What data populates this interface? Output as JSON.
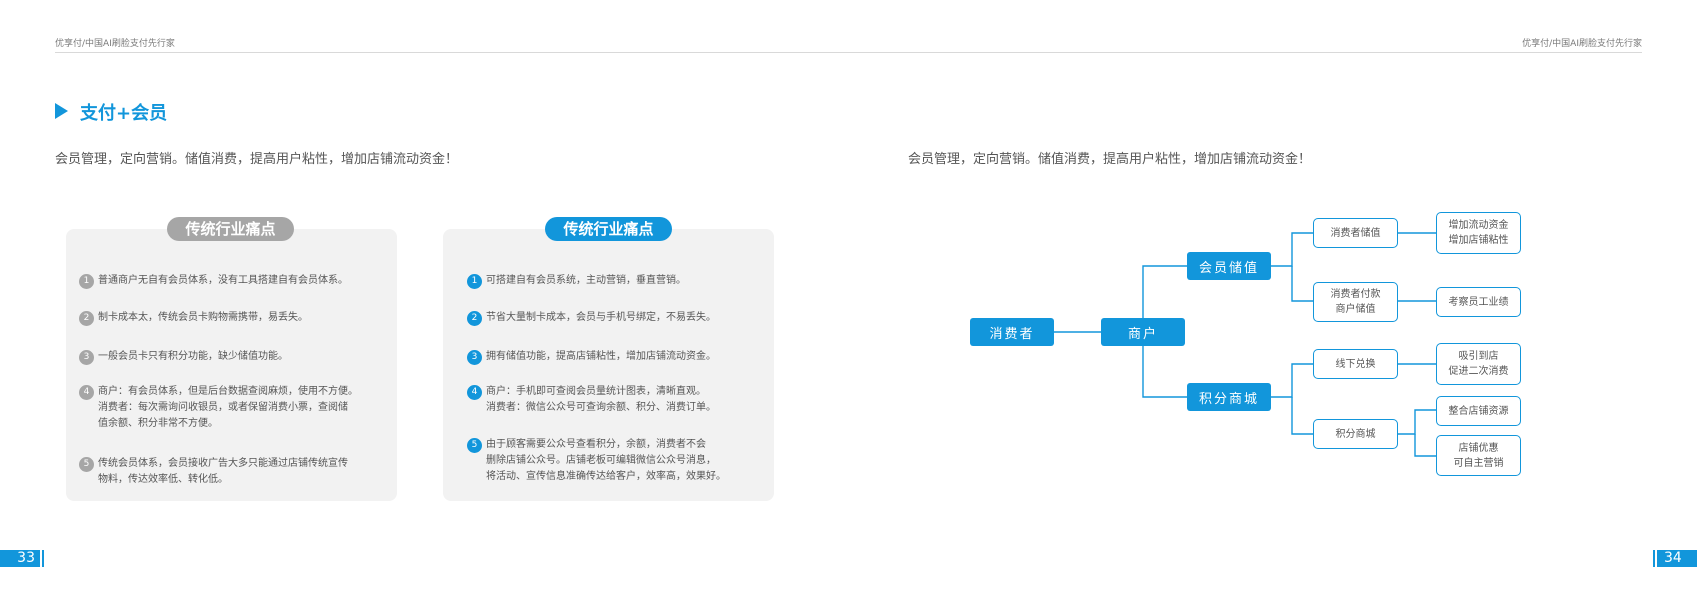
{
  "header": {
    "left_text": "优享付/中国AI刷脸支付先行家",
    "right_text": "优享付/中国AI刷脸支付先行家"
  },
  "section_title": "支付+会员",
  "subtitle_left": "会员管理，定向营销。储值消费，提高用户粘性，增加店铺流动资金！",
  "subtitle_right": "会员管理，定向营销。储值消费，提高用户粘性，增加店铺流动资金！",
  "left_card": {
    "title": "传统行业痛点",
    "items": [
      {
        "num": "1",
        "text": "普通商户无自有会员体系，没有工具搭建自有会员体系。"
      },
      {
        "num": "2",
        "text": "制卡成本太，传统会员卡购物需携带，易丢失。"
      },
      {
        "num": "3",
        "text": "一般会员卡只有积分功能，缺少储值功能。"
      },
      {
        "num": "4",
        "text": "商户：有会员体系，但是后台数据查阅麻烦，使用不方便。\n消费者：每次需询问收银员，或者保留消费小票，查阅储\n值余额、积分非常不方便。"
      },
      {
        "num": "5",
        "text": "传统会员体系，会员接收广告大多只能通过店铺传统宣传\n物料，传达效率低、转化低。"
      }
    ]
  },
  "right_card": {
    "title": "传统行业痛点",
    "items": [
      {
        "num": "1",
        "text": "可搭建自有会员系统，主动营销，垂直营销。"
      },
      {
        "num": "2",
        "text": "节省大量制卡成本，会员与手机号绑定，不易丢失。"
      },
      {
        "num": "3",
        "text": "拥有储值功能，提高店铺粘性，增加店铺流动资金。"
      },
      {
        "num": "4",
        "text": "商户：手机即可查阅会员量统计图表，清晰直观。\n消费者：微信公众号可查询余额、积分、消费订单。"
      },
      {
        "num": "5",
        "text": "由于顾客需要公众号查看积分，余额，消费者不会\n删除店铺公众号。店铺老板可编辑微信公众号消息，\n将活动、宣传信息准确传达给客户，效率高，效果好。"
      }
    ]
  },
  "diagram": {
    "consumer": "消费者",
    "merchant": "商户",
    "member_stored_value": "会员储值",
    "points_mall": "积分商城",
    "consumer_stored_value": "消费者储值",
    "consumer_pay_merchant_stored": "消费者付款\n商户储值",
    "offline_redeem": "线下兑换",
    "points_mall_sub": "积分商城",
    "add_cash_flow": "增加流动资金\n增加店铺粘性",
    "staff_performance": "考察员工业绩",
    "attract_visit": "吸引到店\n促进二次消费",
    "integrate_resources": "整合店铺资源",
    "store_offers": "店铺优惠\n可自主营销"
  },
  "page_left": "33",
  "page_right": "34",
  "colors": {
    "accent": "#1296db",
    "gray_pill": "#a6a6a6",
    "card_bg": "#f2f2f2"
  }
}
